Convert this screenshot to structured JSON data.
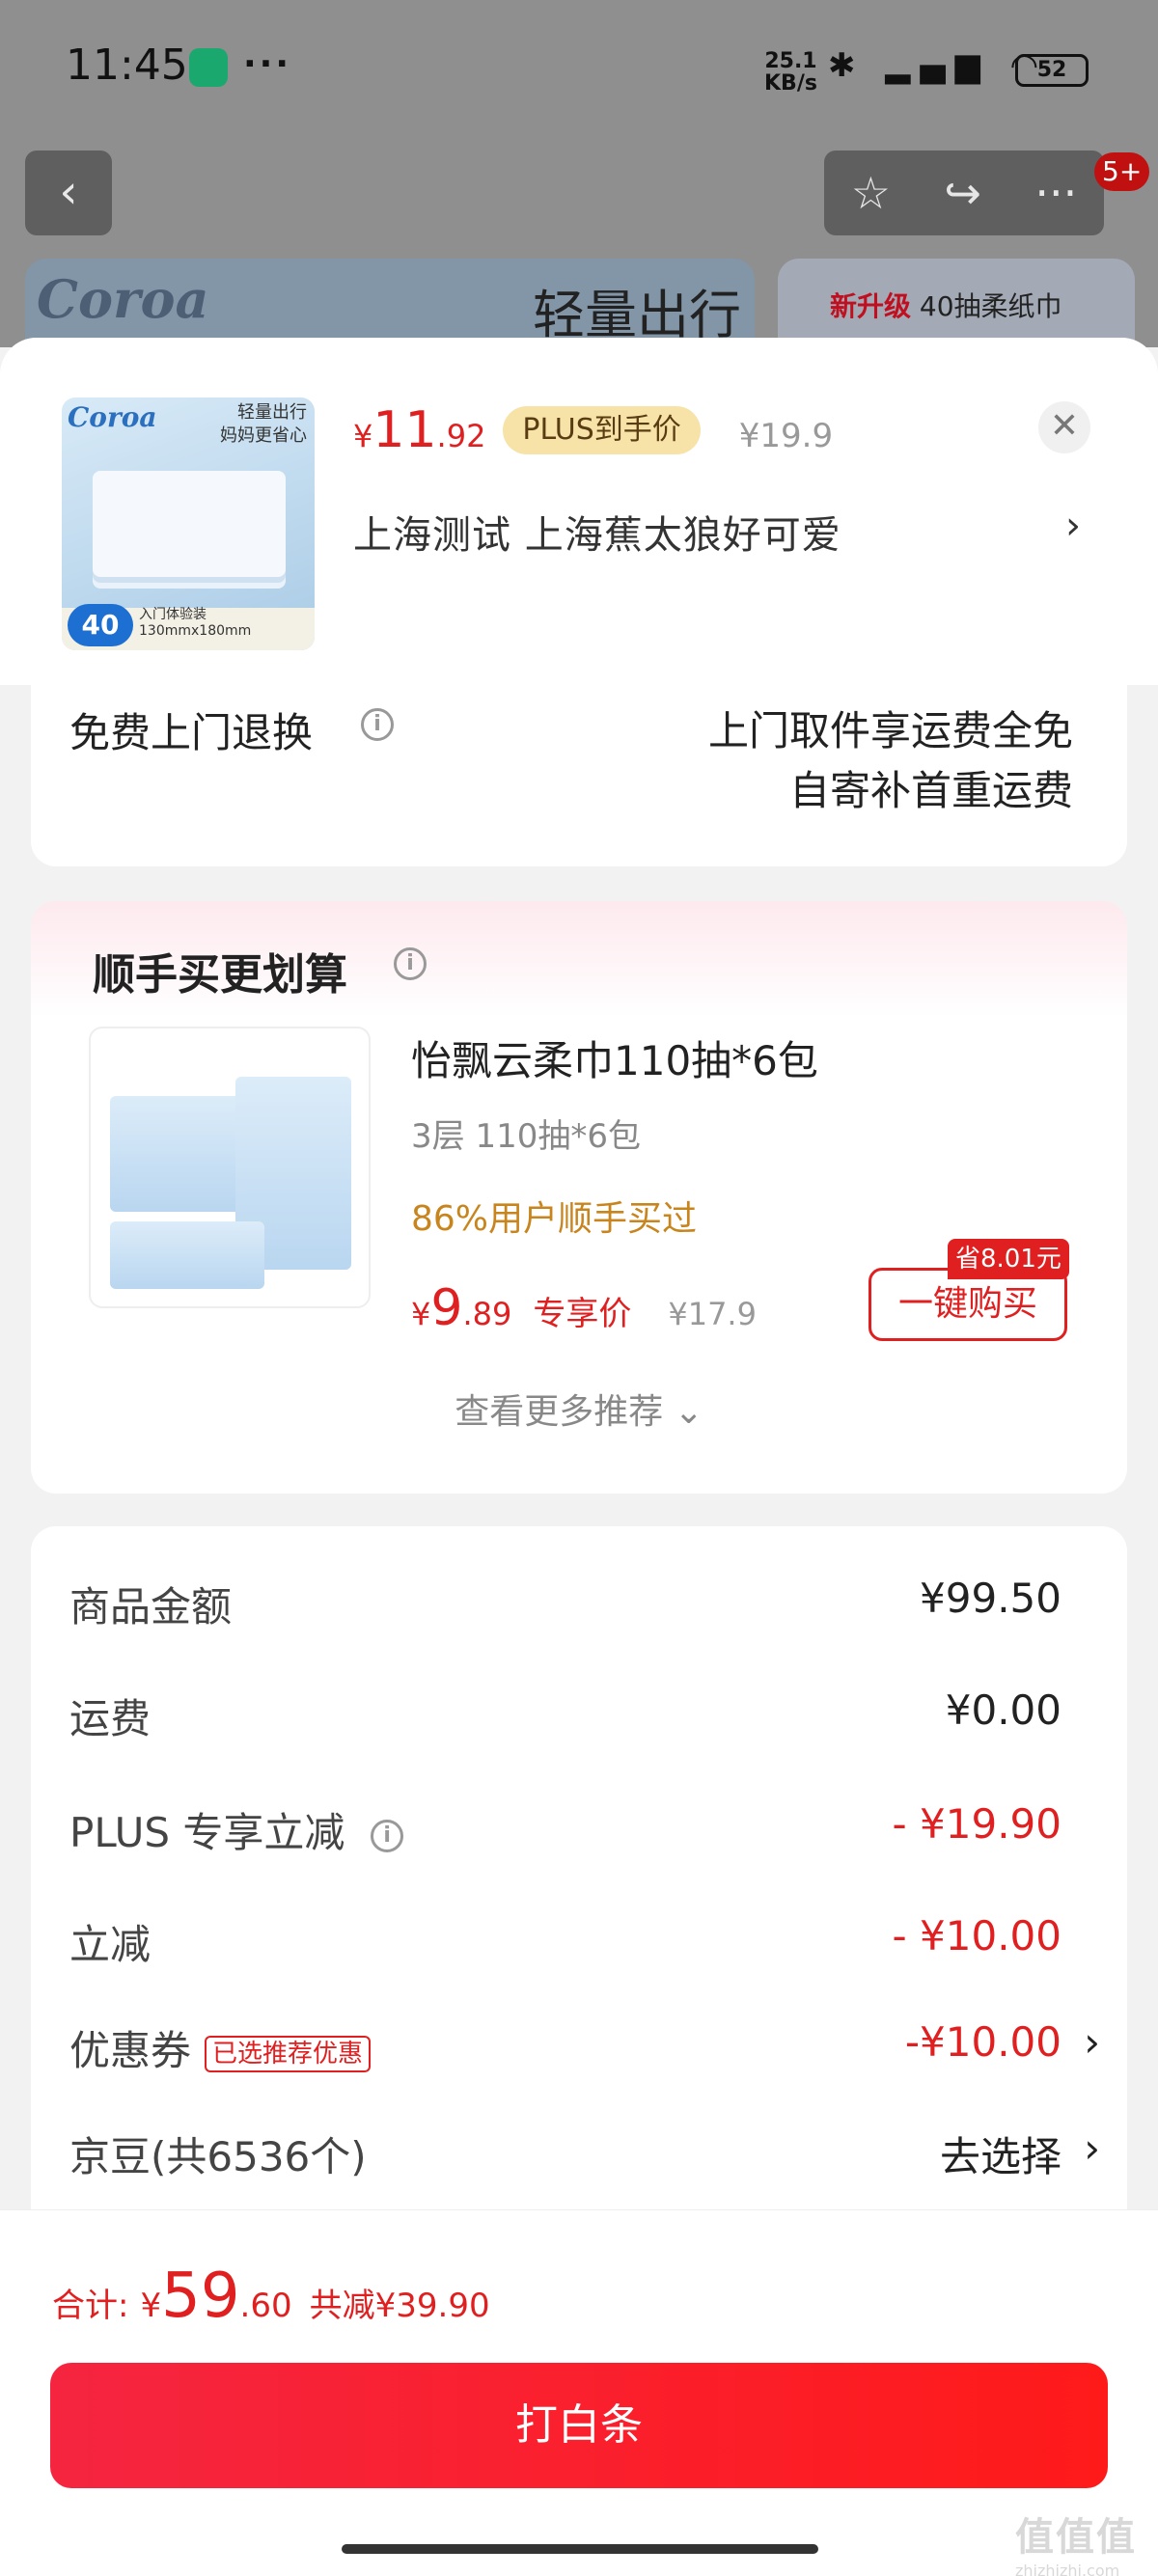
{
  "status_bar": {
    "time": "11:45",
    "more": "···",
    "net_speed_top": "25.1",
    "net_speed_bottom": "KB/s",
    "icons": "✱ ▂▄▆ ◠",
    "battery": "52"
  },
  "background_page": {
    "back_icon": "‹",
    "favorite_icon": "☆",
    "share_icon": "↪",
    "more_icon": "···",
    "badge": "5+",
    "banner_left_title": "轻量出行",
    "banner_right_highlight": "新升级",
    "banner_right_text": " 40抽柔纸巾"
  },
  "product": {
    "thumb_brand": "Coroa",
    "thumb_tagline_1": "轻量出行",
    "thumb_tagline_2": "妈妈更省心",
    "thumb_count": "40",
    "thumb_size": "入门体验装130mmx180mm",
    "price_currency": "¥",
    "price_int": "11",
    "price_dec": ".92",
    "plus_label": "PLUS到手价",
    "original_price": "¥19.9",
    "close_icon": "✕",
    "address": "上海测试  上海蕉太狼好可爱",
    "address_chevron": "›"
  },
  "return_service": {
    "label": "免费上门退换",
    "info_icon": "i",
    "line1": "上门取件享运费全免",
    "line2": "自寄补首重运费"
  },
  "upsell": {
    "title": "顺手买更划算",
    "info_icon": "i",
    "product_name": "怡飘云柔巾110抽*6包",
    "spec": "3层 110抽*6包",
    "buyers": "86%用户顺手买过",
    "price_currency": "¥",
    "price_int": "9",
    "price_dec": ".89",
    "price_tag": "专享价",
    "original_price": "¥17.9",
    "save_badge": "省8.01元",
    "buy_button": "一键购买",
    "more": "查看更多推荐 ⌄"
  },
  "summary": {
    "rows": [
      {
        "label": "商品金额",
        "value": "¥99.50"
      },
      {
        "label": "运费",
        "value": "¥0.00"
      },
      {
        "label": "PLUS 专享立减",
        "value": "- ¥19.90"
      },
      {
        "label": "立减",
        "value": "- ¥10.00"
      },
      {
        "label": "优惠券",
        "value": "-¥10.00",
        "tag": "已选推荐优惠"
      },
      {
        "label": "京豆(共6536个)",
        "value": "去选择"
      }
    ],
    "chevron": "›"
  },
  "footer": {
    "total_label": "合计:",
    "total_currency": "¥",
    "total_int": "59",
    "total_dec": ".60",
    "total_reduce": "共减¥39.90",
    "pay_button": "打白条",
    "watermark": "值值值",
    "watermark_url": "zhizhizhi.com"
  },
  "colors": {
    "accent_red": "#e02020",
    "plus_gold": "#f7e3a8",
    "buyers_orange": "#c8851e"
  }
}
